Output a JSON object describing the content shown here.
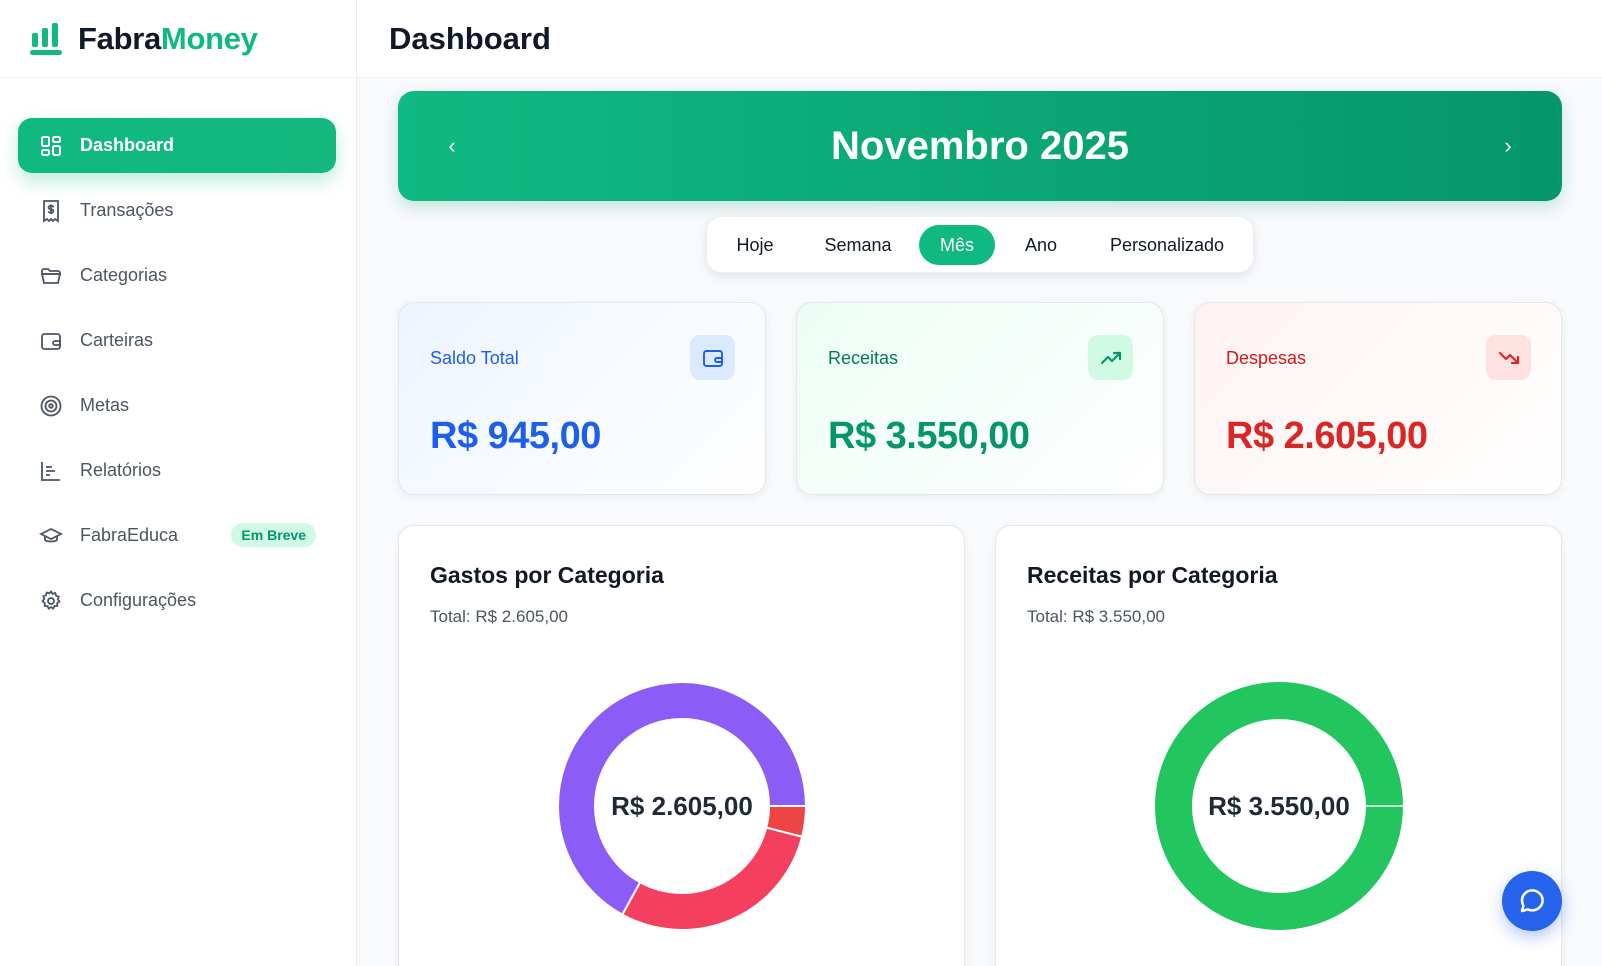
{
  "brand": {
    "part1": "Fabra",
    "part2": "Money"
  },
  "header": {
    "title": "Dashboard"
  },
  "sidebar": {
    "items": [
      {
        "label": "Dashboard",
        "icon": "dashboard-icon",
        "active": true
      },
      {
        "label": "Transações",
        "icon": "receipt-icon"
      },
      {
        "label": "Categorias",
        "icon": "folder-icon"
      },
      {
        "label": "Carteiras",
        "icon": "wallet-icon"
      },
      {
        "label": "Metas",
        "icon": "target-icon"
      },
      {
        "label": "Relatórios",
        "icon": "bar-chart-icon"
      },
      {
        "label": "FabraEduca",
        "icon": "graduation-cap-icon",
        "badge": "Em Breve"
      },
      {
        "label": "Configurações",
        "icon": "gear-icon"
      }
    ]
  },
  "period": {
    "month_label": "Novembro 2025",
    "prev_symbol": "‹",
    "next_symbol": "›",
    "tabs": [
      "Hoje",
      "Semana",
      "Mês",
      "Ano",
      "Personalizado"
    ],
    "active_tab": "Mês"
  },
  "stats": {
    "balance": {
      "label": "Saldo Total",
      "value": "R$ 945,00",
      "icon": "wallet-icon",
      "color": "#1d5eea"
    },
    "income": {
      "label": "Receitas",
      "value": "R$ 3.550,00",
      "icon": "trending-up-icon",
      "color": "#059669"
    },
    "expenses": {
      "label": "Despesas",
      "value": "R$ 2.605,00",
      "icon": "trending-down-icon",
      "color": "#dc2626"
    }
  },
  "expense_chart": {
    "title": "Gastos por Categoria",
    "total_text": "Total: R$ 2.605,00",
    "center_text": "R$ 2.605,00"
  },
  "income_chart": {
    "title": "Receitas por Categoria",
    "total_text": "Total: R$ 3.550,00",
    "center_text": "R$ 3.550,00"
  },
  "chart_data": [
    {
      "type": "pie",
      "title": "Gastos por Categoria",
      "values": [
        0.04,
        0.29,
        0.67
      ],
      "colors": [
        "#ef4444",
        "#f43f5e",
        "#8b5cf6"
      ]
    },
    {
      "type": "pie",
      "title": "Receitas por Categoria",
      "values": [
        1.0
      ],
      "colors": [
        "#22c55e"
      ]
    }
  ],
  "chat": {
    "icon": "chat-bubble-icon"
  }
}
